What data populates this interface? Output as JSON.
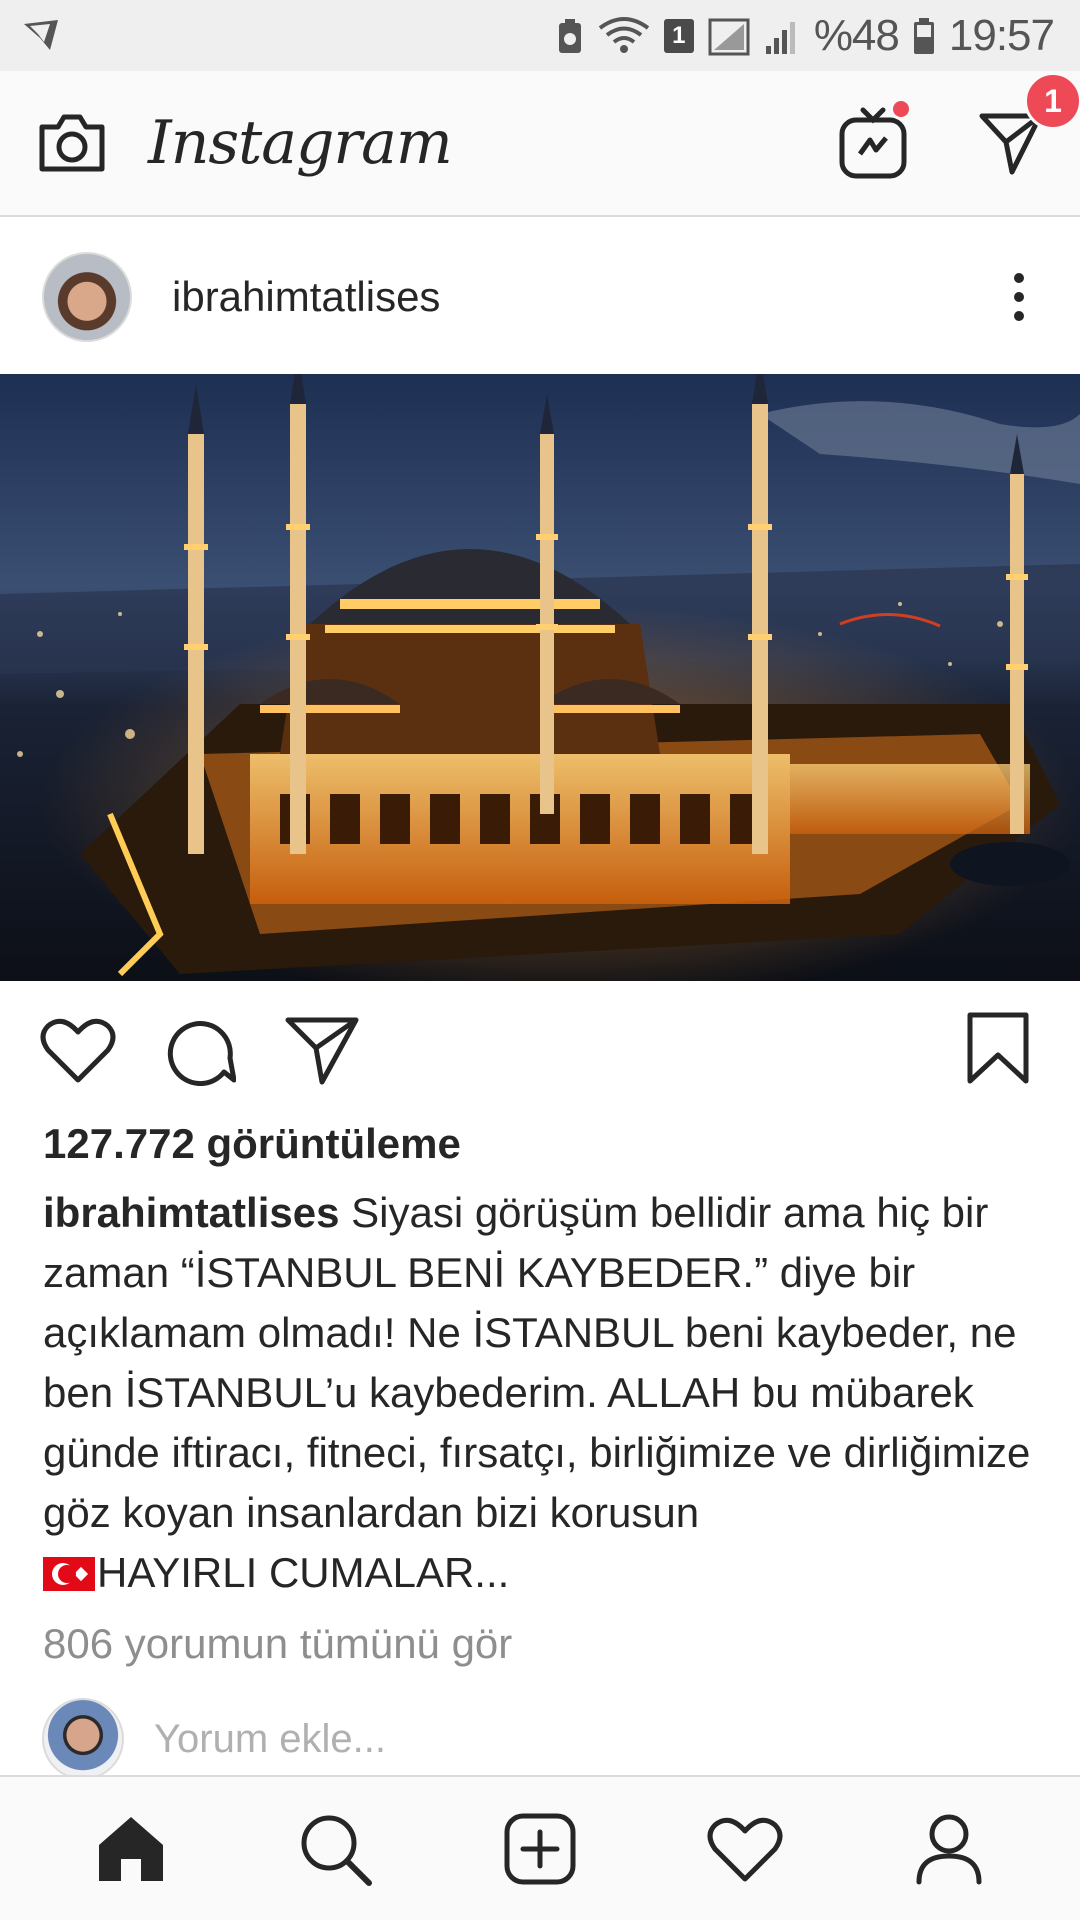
{
  "status_bar": {
    "sim_badge": "1",
    "battery": "%48",
    "time": "19:57"
  },
  "app": {
    "title": "Instagram",
    "dm_badge_count": "1",
    "icons": [
      "camera-icon",
      "igtv-icon",
      "direct-icon"
    ]
  },
  "post": {
    "username": "ibrahimtatlises",
    "views": "127.772 görüntüleme",
    "caption_user": "ibrahimtatlises",
    "caption_text": " Siyasi görüşüm bellidir ama hiç bir zaman “İSTANBUL BENİ KAYBEDER.” diye bir açıklamam olmadı! Ne İSTANBUL beni kaybeder, ne ben İSTANBUL’u kaybederim. ALLAH bu mübarek günde iftiracı, fitneci, fırsatçı, birliğimize ve dirliğimize göz koyan insanlardan bizi korusun ",
    "caption_tail": "HAYIRLI CUMALAR...",
    "view_comments": "806 yorumun tümünü gör",
    "comment_placeholder": "Yorum ekle..."
  },
  "bottom_nav": {
    "items": [
      "home-icon",
      "search-icon",
      "new-post-icon",
      "activity-icon",
      "profile-icon"
    ]
  }
}
